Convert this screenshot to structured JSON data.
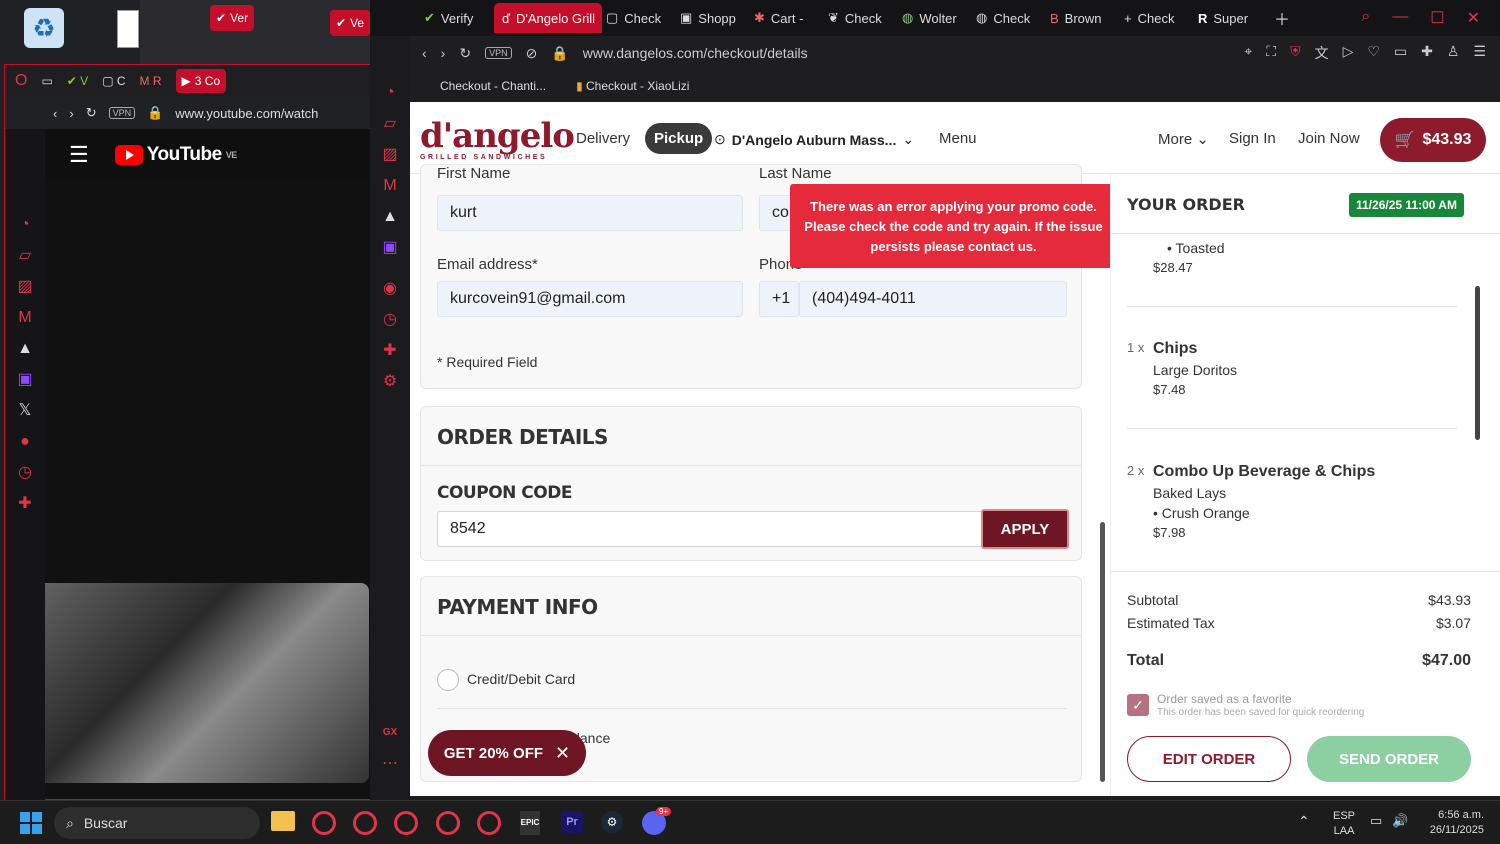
{
  "youtube": {
    "addr": "www.youtube.com/watch",
    "logo": "YouTube",
    "country": "VE",
    "tab_count": "3 Co"
  },
  "left_tabs": [
    "Ver",
    "Ve"
  ],
  "main_tabs": [
    "Verify",
    "D'Angelo Grill",
    "Check",
    "Shopp",
    "Cart -",
    "Check",
    "Wolter",
    "Check",
    "Brown",
    "Check",
    "Super"
  ],
  "main_addr": "www.dangelos.com/checkout/details",
  "bookmarks": [
    "Checkout - Chanti...",
    "Checkout - XiaoLizi"
  ],
  "nav": {
    "logo": "d'angelo",
    "logo_sub": "GRILLED SANDWICHES",
    "delivery": "Delivery",
    "pickup": "Pickup",
    "location": "D'Angelo Auburn Mass...",
    "menu": "Menu",
    "more": "More",
    "sign_in": "Sign In",
    "join": "Join Now",
    "cart_total": "$43.93"
  },
  "form": {
    "first_name_label": "First Name",
    "first_name": "kurt",
    "last_name_label": "Last Name",
    "last_name": "col",
    "email_label": "Email address*",
    "email": "kurcovein91@gmail.com",
    "phone_label": "Phone",
    "phone_prefix": "+1",
    "phone": "(404)494-4011",
    "required": "* Required Field",
    "order_details": "ORDER DETAILS",
    "coupon_label": "COUPON CODE",
    "coupon": "8542",
    "apply": "APPLY",
    "payment_info": "PAYMENT INFO",
    "pay_card": "Credit/Debit Card",
    "pay_balance": "alance"
  },
  "error_msg": "There was an error applying your promo code. Please check the code and try again. If the issue persists please contact us.",
  "promo": "GET 20% OFF",
  "order": {
    "title": "YOUR ORDER",
    "date": "11/26/25 11:00 AM",
    "item0_mod": "• Toasted",
    "item0_price": "$28.47",
    "item1_qty": "1 x",
    "item1_name": "Chips",
    "item1_mod": "Large Doritos",
    "item1_price": "$7.48",
    "item2_qty": "2 x",
    "item2_name": "Combo Up Beverage & Chips",
    "item2_mod1": "Baked Lays",
    "item2_mod2": "• Crush Orange",
    "item2_price": "$7.98",
    "subtotal_label": "Subtotal",
    "subtotal": "$43.93",
    "tax_label": "Estimated Tax",
    "tax": "$3.07",
    "total_label": "Total",
    "total": "$47.00",
    "fav_title": "Order saved as a favorite",
    "fav_sub": "This order has been saved for quick reordering",
    "edit": "EDIT ORDER",
    "send": "SEND ORDER"
  },
  "taskbar": {
    "search": "Buscar",
    "lang1": "ESP",
    "lang2": "LAA",
    "time": "6:56 a.m.",
    "date": "26/11/2025",
    "badge": "9+"
  }
}
